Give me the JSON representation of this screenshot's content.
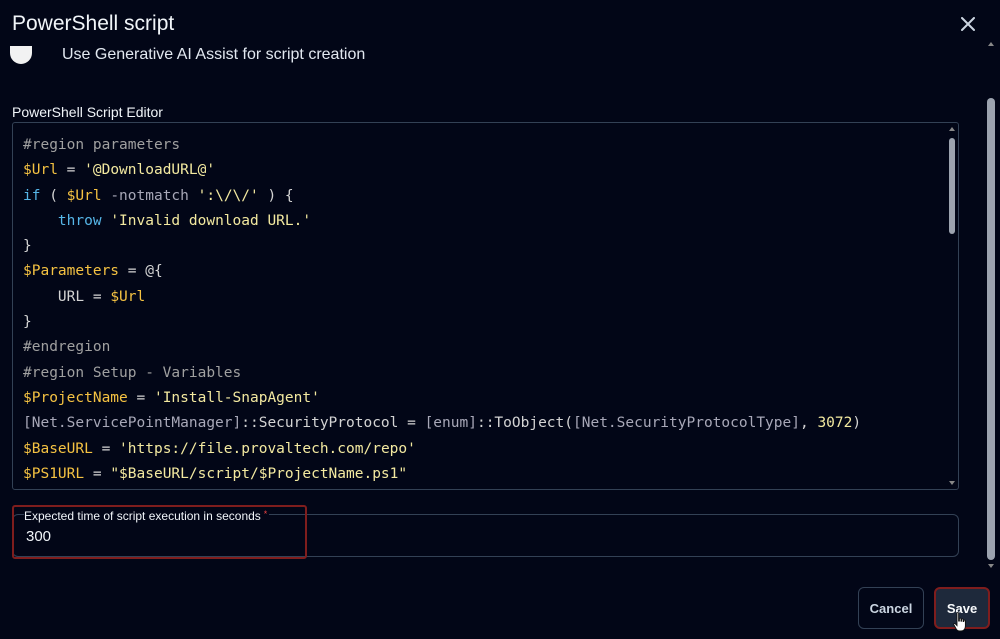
{
  "dialog": {
    "title": "PowerShell script",
    "close_icon": "close-icon"
  },
  "ai_assist": {
    "label": "Use Generative AI Assist for script creation"
  },
  "editor": {
    "label": "PowerShell Script Editor",
    "lines": [
      [
        {
          "t": "#region parameters",
          "c": "comment"
        }
      ],
      [
        {
          "t": "$Url",
          "c": "var"
        },
        {
          "t": " = ",
          "c": "op"
        },
        {
          "t": "'@DownloadURL@'",
          "c": "str"
        }
      ],
      [
        {
          "t": "if",
          "c": "kw"
        },
        {
          "t": " ( ",
          "c": "op"
        },
        {
          "t": "$Url",
          "c": "var"
        },
        {
          "t": " -notmatch ",
          "c": "type"
        },
        {
          "t": "':\\/\\/'",
          "c": "str"
        },
        {
          "t": " ) {",
          "c": "op"
        }
      ],
      [
        {
          "t": "    ",
          "c": "op"
        },
        {
          "t": "throw",
          "c": "kw"
        },
        {
          "t": " ",
          "c": "op"
        },
        {
          "t": "'Invalid download URL.'",
          "c": "str"
        }
      ],
      [
        {
          "t": "}",
          "c": "op"
        }
      ],
      [
        {
          "t": "$Parameters",
          "c": "var"
        },
        {
          "t": " = @{",
          "c": "op"
        }
      ],
      [
        {
          "t": "    URL = ",
          "c": "op"
        },
        {
          "t": "$Url",
          "c": "var"
        }
      ],
      [
        {
          "t": "}",
          "c": "op"
        }
      ],
      [
        {
          "t": "#endregion",
          "c": "comment"
        }
      ],
      [
        {
          "t": "#region Setup - Variables",
          "c": "comment"
        }
      ],
      [
        {
          "t": "$ProjectName",
          "c": "var"
        },
        {
          "t": " = ",
          "c": "op"
        },
        {
          "t": "'Install-SnapAgent'",
          "c": "str"
        }
      ],
      [
        {
          "t": "[Net.ServicePointManager]",
          "c": "type"
        },
        {
          "t": "::SecurityProtocol = ",
          "c": "op"
        },
        {
          "t": "[enum]",
          "c": "type"
        },
        {
          "t": "::ToObject(",
          "c": "op"
        },
        {
          "t": "[Net.SecurityProtocolType]",
          "c": "type"
        },
        {
          "t": ", ",
          "c": "op"
        },
        {
          "t": "3072",
          "c": "num"
        },
        {
          "t": ")",
          "c": "op"
        }
      ],
      [
        {
          "t": "$BaseURL",
          "c": "var"
        },
        {
          "t": " = ",
          "c": "op"
        },
        {
          "t": "'https://file.provaltech.com/repo'",
          "c": "str"
        }
      ],
      [
        {
          "t": "$PS1URL",
          "c": "var"
        },
        {
          "t": " = ",
          "c": "op"
        },
        {
          "t": "\"$BaseURL/script/$ProjectName.ps1\"",
          "c": "str"
        }
      ]
    ]
  },
  "execution_time": {
    "label": "Expected time of script execution in seconds",
    "required_mark": "*",
    "value": "300"
  },
  "footer": {
    "cancel_label": "Cancel",
    "save_label": "Save"
  }
}
